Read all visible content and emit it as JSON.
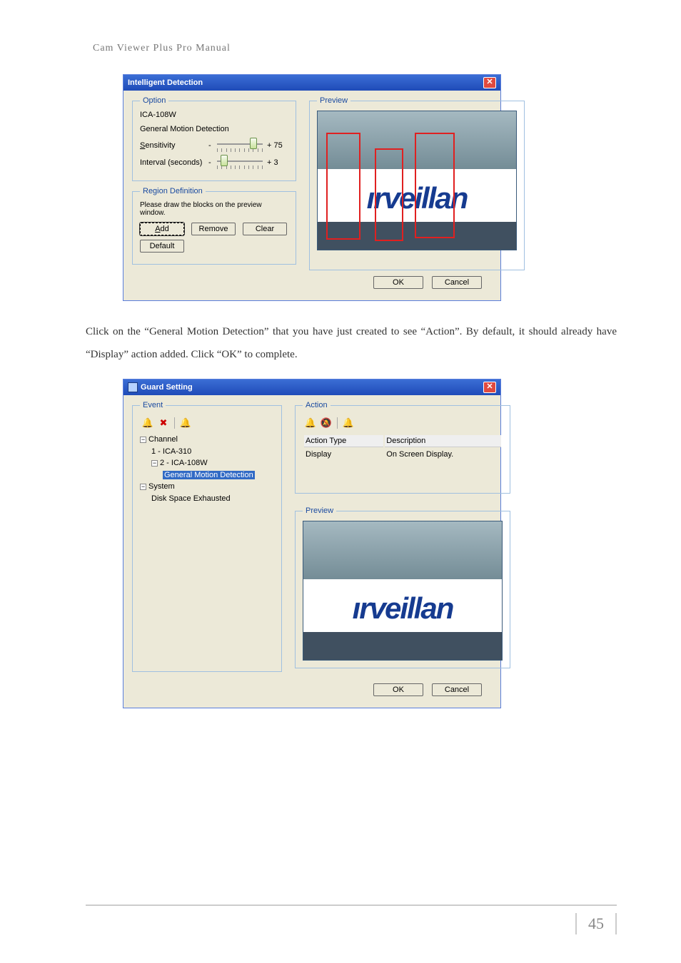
{
  "header": "Cam Viewer Plus Pro Manual",
  "dialog1": {
    "title": "Intelligent Detection",
    "option_legend": "Option",
    "device": "ICA-108W",
    "mode": "General Motion Detection",
    "sensitivity_label": "Sensitivity",
    "sensitivity_value": "+ 75",
    "interval_label": "Interval (seconds)",
    "interval_value": "+ 3",
    "region_legend": "Region Definition",
    "region_hint": "Please draw the blocks on the preview window.",
    "btn_add": "Add",
    "btn_remove": "Remove",
    "btn_clear": "Clear",
    "btn_default": "Default",
    "preview_legend": "Preview",
    "btn_ok": "OK",
    "btn_cancel": "Cancel"
  },
  "body_text": "Click on the “General Motion Detection” that you have just created to see “Action”. By default, it should already have “Display” action added. Click “OK” to complete.",
  "dialog2": {
    "title": "Guard Setting",
    "event_legend": "Event",
    "tree": {
      "channel": "Channel",
      "c1": "1 - ICA-310",
      "c2": "2 - ICA-108W",
      "gmd": "General Motion Detection",
      "system": "System",
      "disk": "Disk Space Exhausted"
    },
    "action_legend": "Action",
    "col1": "Action Type",
    "col2": "Description",
    "row1_type": "Display",
    "row1_desc": "On Screen Display.",
    "preview_legend": "Preview",
    "btn_ok": "OK",
    "btn_cancel": "Cancel"
  },
  "banner_text": "ırveillan",
  "page_number": "45"
}
